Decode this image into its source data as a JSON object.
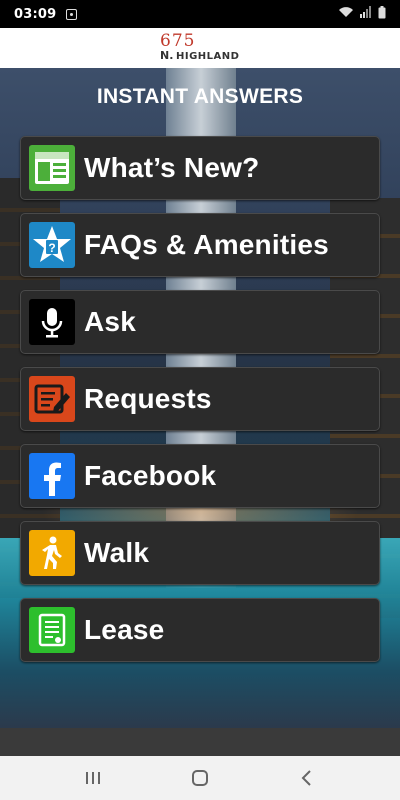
{
  "status_bar": {
    "time": "03:09",
    "icons": [
      "notification-icon",
      "wifi-icon",
      "signal-icon",
      "battery-icon"
    ]
  },
  "brand": {
    "logo_number": "675",
    "logo_prefix": "N.",
    "logo_street": "HIGHLAND"
  },
  "page": {
    "title": "INSTANT ANSWERS"
  },
  "menu": {
    "items": [
      {
        "label": "What’s New?",
        "icon": "news-window-icon",
        "icon_bg": "#4caf3a"
      },
      {
        "label": "FAQs & Amenities",
        "icon": "star-question-icon",
        "icon_bg": "#1e88c7"
      },
      {
        "label": "Ask",
        "icon": "microphone-icon",
        "icon_bg": "#000000"
      },
      {
        "label": "Requests",
        "icon": "edit-document-icon",
        "icon_bg": "#d9471b"
      },
      {
        "label": "Facebook",
        "icon": "facebook-icon",
        "icon_bg": "#1877f2"
      },
      {
        "label": "Walk",
        "icon": "walking-person-icon",
        "icon_bg": "#f2a900"
      },
      {
        "label": "Lease",
        "icon": "lease-document-icon",
        "icon_bg": "#2dbf2d"
      }
    ]
  },
  "nav_bar": {
    "buttons": [
      "recent-apps-icon",
      "home-icon",
      "back-icon"
    ]
  },
  "colors": {
    "button_bg": "#2b2b2b",
    "title_text": "#ffffff",
    "logo_accent": "#c0392b"
  }
}
